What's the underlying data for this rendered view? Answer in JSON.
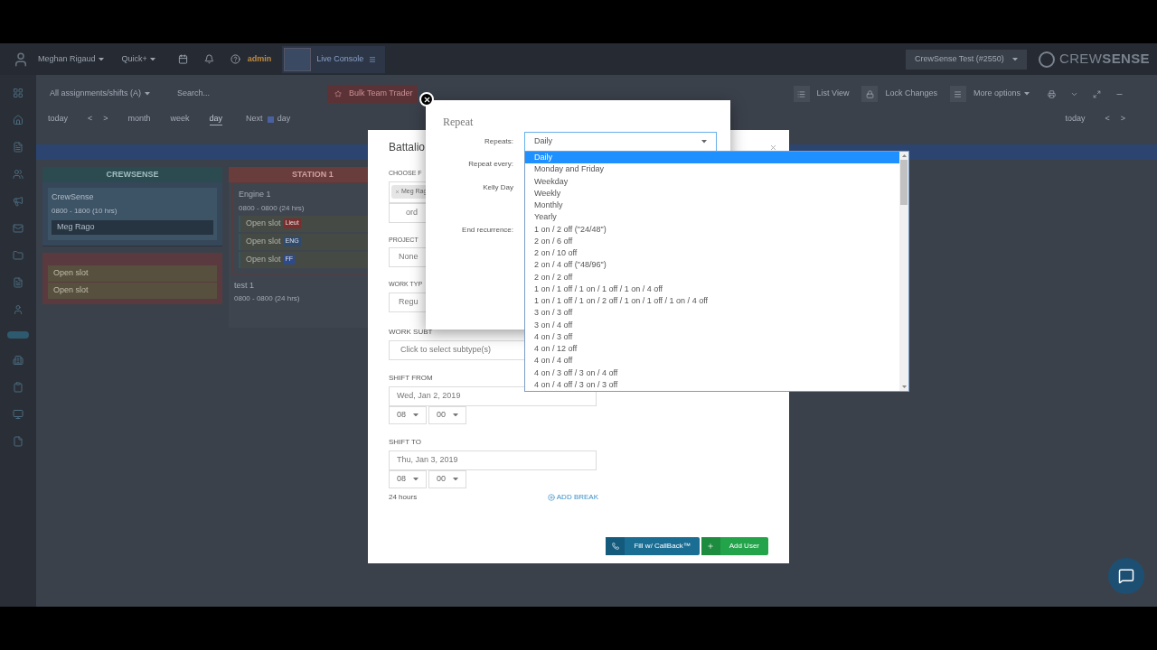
{
  "top_nav": {
    "user": "Meghan Rigaud",
    "quick": "Quick+",
    "role": "admin",
    "console": "Live Console",
    "account": "CrewSense Test (#2550)",
    "logo": "CREW**SENSE**"
  },
  "toolbar": {
    "filter": "All assignments/shifts (A)",
    "search_placeholder": "Search...",
    "trade_button": "Bulk Team Trader",
    "actions": [
      "List View",
      "Lock Changes",
      "More options"
    ],
    "nav_left": [
      "today",
      "<",
      ">"
    ],
    "views": [
      {
        "label": "month",
        "selected": false
      },
      {
        "label": "week",
        "selected": false
      },
      {
        "label": "day",
        "selected": true
      }
    ],
    "next": "Next",
    "next_unit": "day",
    "nav_right": [
      "today",
      "<",
      ">"
    ]
  },
  "crew_card": {
    "title": "CREWSENSE",
    "shift_name": "CrewSense",
    "shift_time": "0800 - 1800 (10 hrs)",
    "assignee": "Meg Rago"
  },
  "unassigned_card": {
    "slots": [
      "Open slot",
      "Open slot"
    ]
  },
  "station_card": {
    "title": "STATION 1",
    "units": [
      {
        "name": "Engine 1",
        "time": "0800 - 0800 (24 hrs)",
        "slots": [
          {
            "label": "Open slot",
            "badge": "Lieut",
            "color": "#7a2e2e"
          },
          {
            "label": "Open slot",
            "badge": "ENG",
            "color": "#2e4a6e"
          },
          {
            "label": "Open slot",
            "badge": "FF",
            "color": "#2e4a8a"
          }
        ]
      },
      {
        "name": "test 1",
        "time": "0800 - 0800 (24 hrs)"
      }
    ]
  },
  "battalion_modal": {
    "title": "Battalio",
    "choose_label": "CHOOSE F",
    "chip": "Meg Rag",
    "second_field": "ord",
    "project_label": "PROJECT",
    "project_value": "None",
    "work_type_label": "WORK TYP",
    "work_type_value": "Regu",
    "subtype_label": "WORK SUBT",
    "subtype_placeholder": "Click to select subtype(s)",
    "shift_from_label": "SHIFT FROM",
    "from_date": "Wed, Jan 2, 2019",
    "from_hour": "08",
    "from_min": "00",
    "shift_to_label": "SHIFT TO",
    "to_date": "Thu, Jan 3, 2019",
    "to_hour": "08",
    "to_min": "00",
    "duration": "24 hours",
    "add_break": "ADD BREAK",
    "buttons": [
      {
        "kind": "callback",
        "label": "Fill w/ CallBack™"
      },
      {
        "kind": "add",
        "label": "Add User"
      }
    ]
  },
  "repeat_modal": {
    "title": "Repeat",
    "labels": [
      "Repeats:",
      "Repeat every:",
      "Kelly Day",
      "End recurrence:"
    ],
    "select_value": "Daily",
    "options": [
      {
        "label": "Daily",
        "selected": true
      },
      {
        "label": "Monday and Friday",
        "selected": false
      },
      {
        "label": "Weekday",
        "selected": false
      },
      {
        "label": "Weekly",
        "selected": false
      },
      {
        "label": "Monthly",
        "selected": false
      },
      {
        "label": "Yearly",
        "selected": false
      },
      {
        "label": "1 on / 2 off (\"24/48\")",
        "selected": false
      },
      {
        "label": "2 on / 6 off",
        "selected": false
      },
      {
        "label": "2 on / 10 off",
        "selected": false
      },
      {
        "label": "2 on / 4 off (\"48/96\")",
        "selected": false
      },
      {
        "label": "2 on / 2 off",
        "selected": false
      },
      {
        "label": "1 on / 1 off / 1 on / 1 off / 1 on / 4 off",
        "selected": false
      },
      {
        "label": "1 on / 1 off / 1 on / 2 off / 1 on / 1 off / 1 on / 4 off",
        "selected": false
      },
      {
        "label": "3 on / 3 off",
        "selected": false
      },
      {
        "label": "3 on / 4 off",
        "selected": false
      },
      {
        "label": "4 on / 3 off",
        "selected": false
      },
      {
        "label": "4 on / 12 off",
        "selected": false
      },
      {
        "label": "4 on / 4 off",
        "selected": false
      },
      {
        "label": "4 on / 3 off / 3 on / 4 off",
        "selected": false
      },
      {
        "label": "4 on / 4 off / 3 on / 3 off",
        "selected": false
      }
    ]
  }
}
